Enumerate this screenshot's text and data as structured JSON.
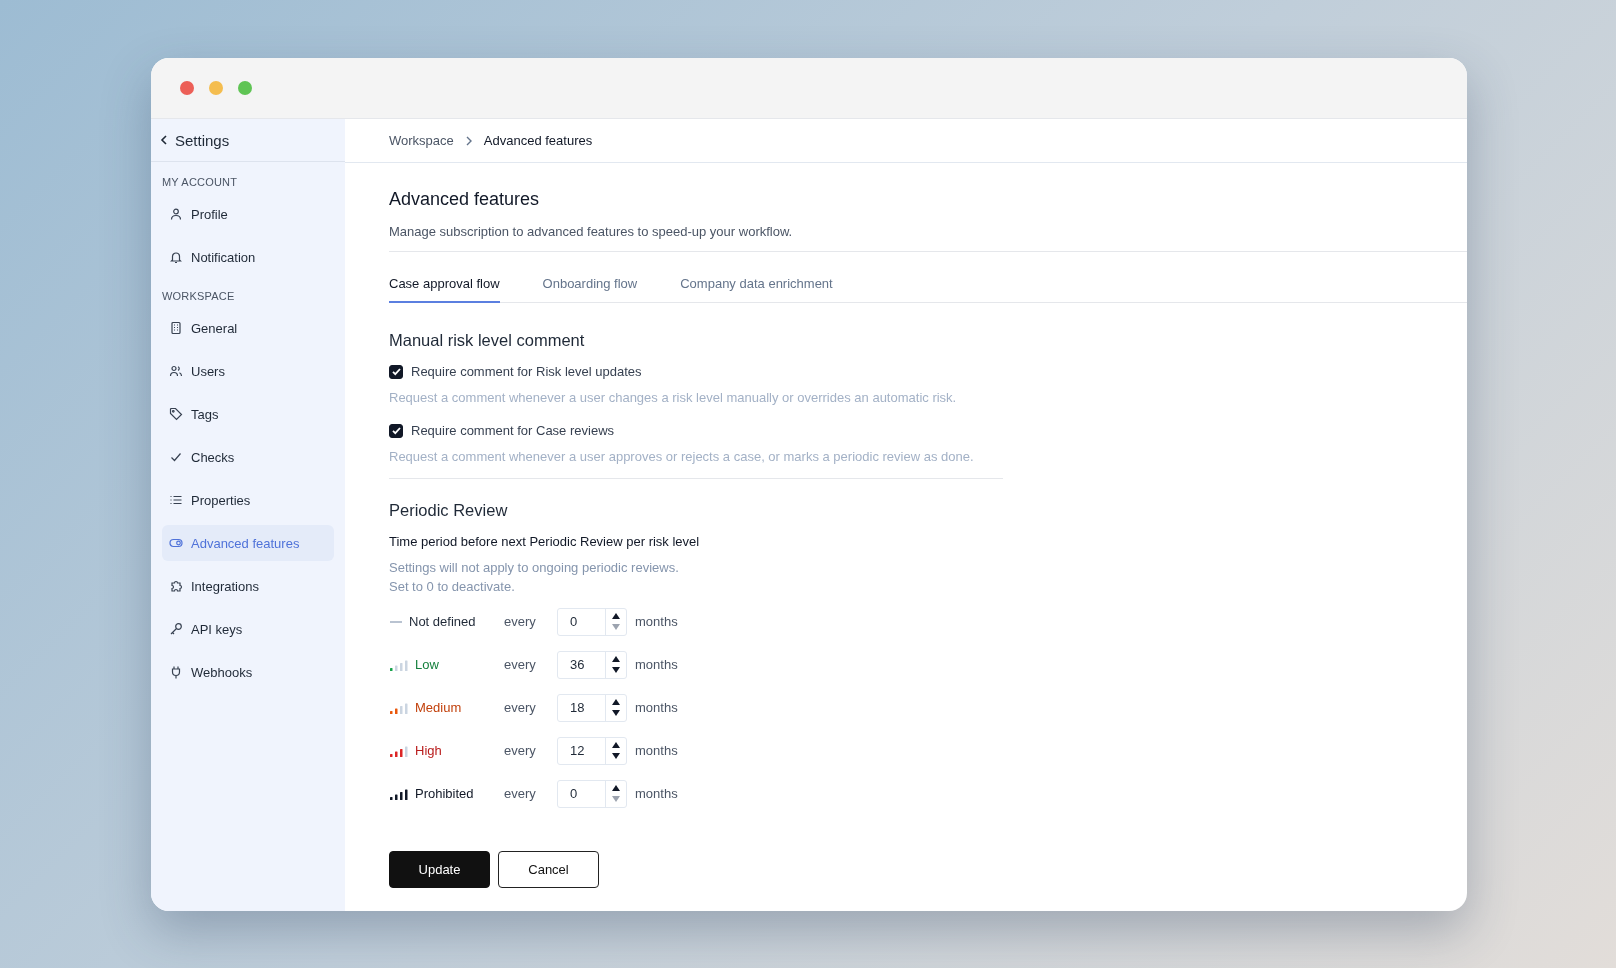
{
  "sidebar": {
    "back_label": "Settings",
    "sections": [
      {
        "heading": "MY ACCOUNT",
        "items": [
          {
            "label": "Profile",
            "kind": "person",
            "selected": false
          },
          {
            "label": "Notification",
            "kind": "bell",
            "selected": false
          }
        ]
      },
      {
        "heading": "WORKSPACE",
        "items": [
          {
            "label": "General",
            "kind": "building",
            "selected": false
          },
          {
            "label": "Users",
            "kind": "users",
            "selected": false
          },
          {
            "label": "Tags",
            "kind": "tag",
            "selected": false
          },
          {
            "label": "Checks",
            "kind": "check",
            "selected": false
          },
          {
            "label": "Properties",
            "kind": "list",
            "selected": false
          },
          {
            "label": "Advanced features",
            "kind": "toggle",
            "selected": true
          },
          {
            "label": "Integrations",
            "kind": "puzzle",
            "selected": false
          },
          {
            "label": "API keys",
            "kind": "key",
            "selected": false
          },
          {
            "label": "Webhooks",
            "kind": "plug",
            "selected": false
          }
        ]
      }
    ]
  },
  "breadcrumb": [
    "Workspace",
    "Advanced features"
  ],
  "page": {
    "title": "Advanced features",
    "description": "Manage subscription to advanced features to speed-up your workflow."
  },
  "tabs": [
    {
      "label": "Case approval flow",
      "selected": true
    },
    {
      "label": "Onboarding flow",
      "selected": false
    },
    {
      "label": "Company data enrichment",
      "selected": false
    }
  ],
  "comment_section": {
    "title": "Manual risk level comment",
    "options": [
      {
        "label": "Require comment for Risk level updates",
        "checked": true,
        "hint": "Request a comment whenever a user changes a risk level manually or overrides an automatic risk."
      },
      {
        "label": "Require comment for Case reviews",
        "checked": true,
        "hint": "Request a comment whenever a user approves or rejects a case, or marks a periodic review as done."
      }
    ]
  },
  "review_section": {
    "title": "Periodic Review",
    "subtitle": "Time period before next Periodic Review per risk level",
    "notes": [
      "Settings will not apply to ongoing periodic reviews.",
      "Set to 0 to deactivate."
    ],
    "levels": [
      {
        "kind": "none",
        "label": "Not defined",
        "every": "every",
        "value": "0",
        "unit": "months",
        "decrement_disabled": true
      },
      {
        "kind": "low",
        "label": "Low",
        "every": "every",
        "value": "36",
        "unit": "months",
        "decrement_disabled": false
      },
      {
        "kind": "medium",
        "label": "Medium",
        "every": "every",
        "value": "18",
        "unit": "months",
        "decrement_disabled": false
      },
      {
        "kind": "high",
        "label": "High",
        "every": "every",
        "value": "12",
        "unit": "months",
        "decrement_disabled": false
      },
      {
        "kind": "prohibited",
        "label": "Prohibited",
        "every": "every",
        "value": "0",
        "unit": "months",
        "decrement_disabled": true
      }
    ]
  },
  "buttons": [
    {
      "label": "Update",
      "kind": "primary"
    },
    {
      "label": "Cancel",
      "kind": "secondary"
    }
  ]
}
